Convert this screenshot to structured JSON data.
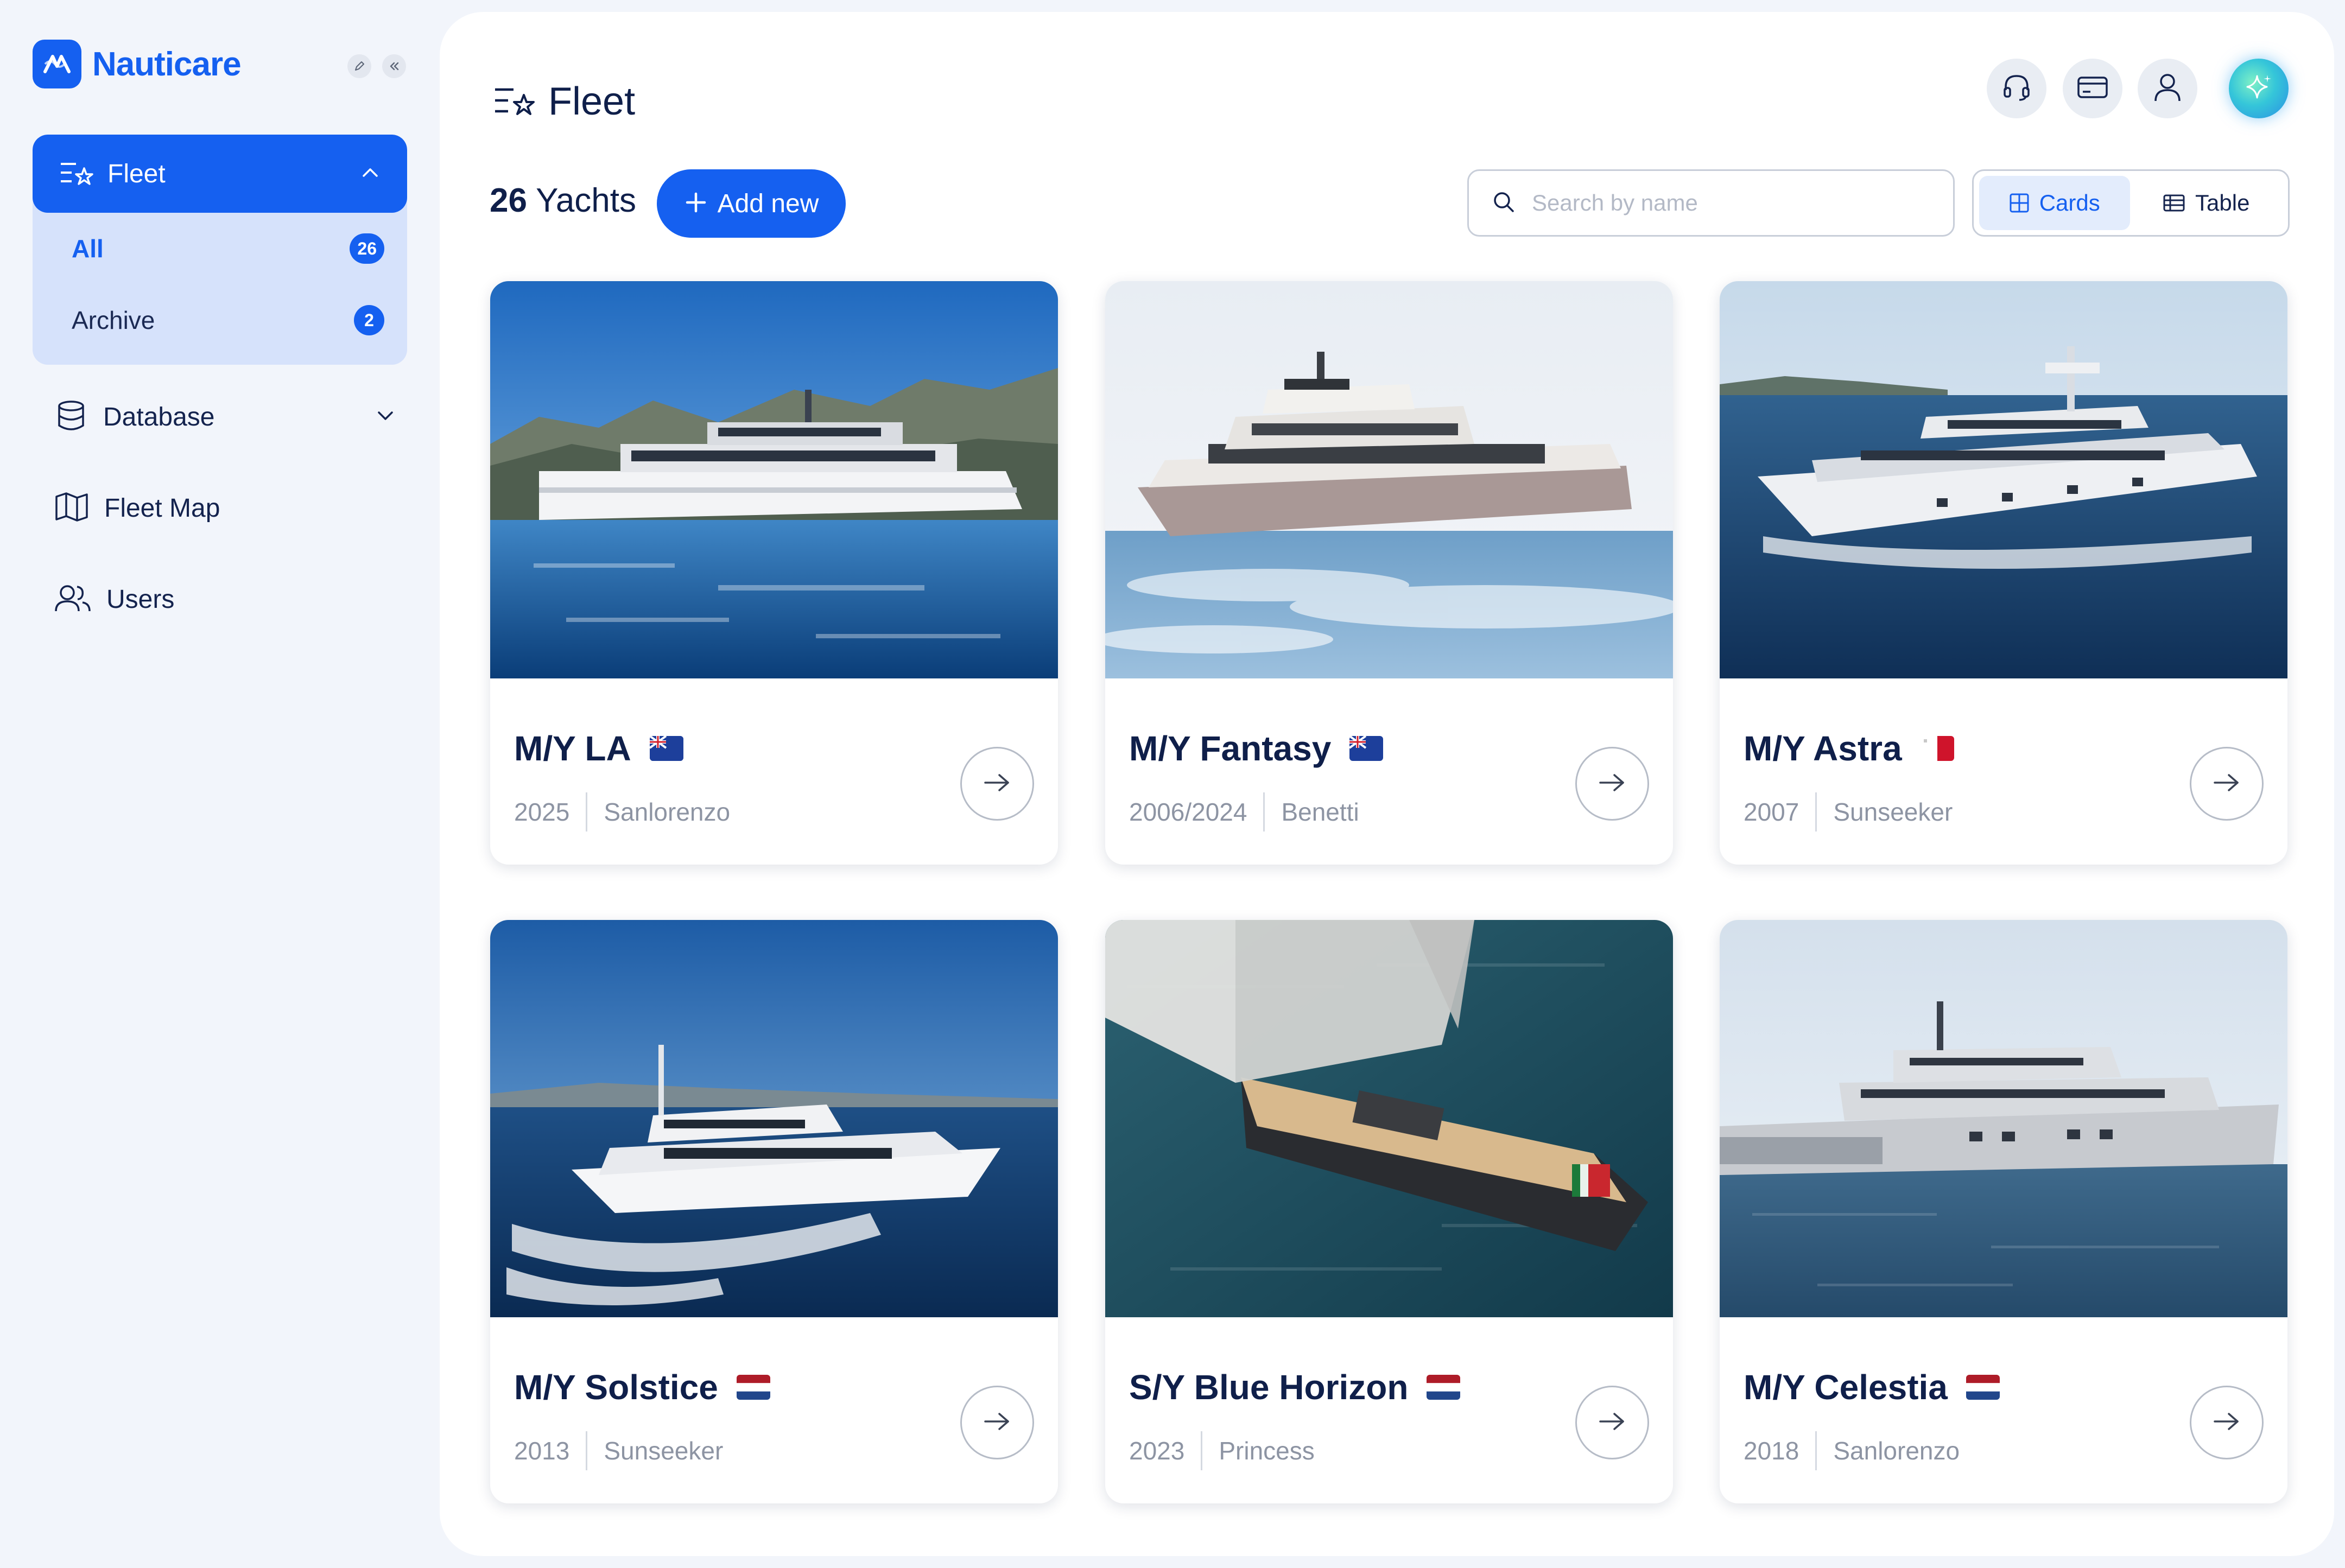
{
  "brand": {
    "name": "Nauticare",
    "logo_icon": "wave-logo-icon"
  },
  "sidebar": {
    "fleet": {
      "label": "Fleet",
      "items": [
        {
          "label": "All",
          "count": "26",
          "active": true
        },
        {
          "label": "Archive",
          "count": "2",
          "active": false
        }
      ]
    },
    "nav": [
      {
        "label": "Database",
        "icon": "database-icon",
        "has_chevron": true
      },
      {
        "label": "Fleet Map",
        "icon": "map-icon"
      },
      {
        "label": "Users",
        "icon": "users-icon"
      }
    ]
  },
  "header": {
    "title": "Fleet",
    "actions": [
      "headset-icon",
      "card-icon",
      "user-icon",
      "sparkle-ai-icon"
    ]
  },
  "toolbar": {
    "count_number": "26",
    "count_label": "Yachts",
    "add_label": "Add new",
    "search_placeholder": "Search by name",
    "views": [
      {
        "label": "Cards",
        "active": true
      },
      {
        "label": "Table",
        "active": false
      }
    ]
  },
  "yachts": [
    {
      "name": "M/Y LA",
      "year": "2025",
      "builder": "Sanlorenzo",
      "flag": "uk-ensign-flag",
      "photo": "motor yacht on blue sea by cliffs"
    },
    {
      "name": "M/Y Fantasy",
      "year": "2006/2024",
      "builder": "Benetti",
      "flag": "uk-ensign-flag",
      "photo": "taupe hull motor yacht cruising"
    },
    {
      "name": "M/Y Astra",
      "year": "2007",
      "builder": "Sunseeker",
      "flag": "malta-flag",
      "photo": "white motor yacht on open sea"
    },
    {
      "name": "M/Y Solstice",
      "year": "2013",
      "builder": "Sunseeker",
      "flag": "netherlands-flag",
      "photo": "white motor yacht at speed"
    },
    {
      "name": "S/Y Blue Horizon",
      "year": "2023",
      "builder": "Princess",
      "flag": "netherlands-flag",
      "photo": "sailing yacht aerial view"
    },
    {
      "name": "M/Y Celestia",
      "year": "2018",
      "builder": "Sanlorenzo",
      "flag": "netherlands-flag",
      "photo": "grey motor yacht at anchor"
    }
  ],
  "colors": {
    "accent": "#1560f0",
    "text": "#0f1f4a",
    "muted": "#8d94a3",
    "panel": "#ffffff",
    "background": "#f2f5fb"
  }
}
